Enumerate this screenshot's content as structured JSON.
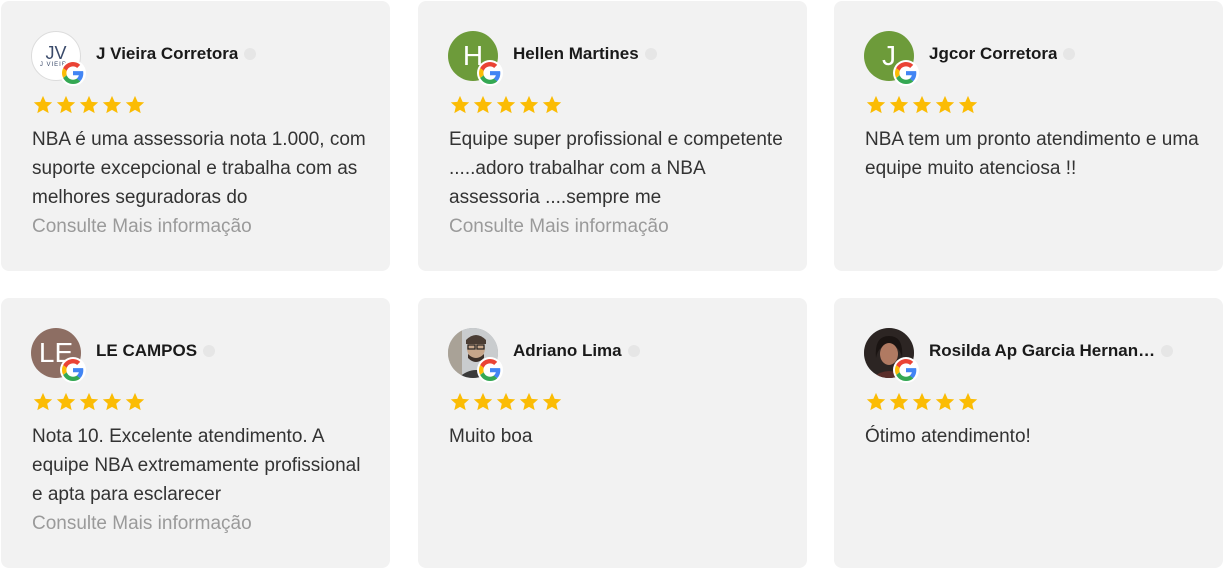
{
  "reviews": [
    {
      "name": "J Vieira Corretora",
      "avatar": {
        "type": "logo",
        "initials": "JV",
        "subtext": "J VIEIRA",
        "color": "#ffffff"
      },
      "rating": 5,
      "text": "NBA é uma assessoria nota 1.000, com suporte excepcional e trabalha com as melhores seguradoras do",
      "more_label": "Consulte Mais informação",
      "source_icon": "google-icon"
    },
    {
      "name": "Hellen Martines",
      "avatar": {
        "type": "initial",
        "initials": "H",
        "color": "#6d9b3a"
      },
      "rating": 5,
      "text": "Equipe super profissional e competente .....adoro trabalhar com a NBA assessoria ....sempre me",
      "more_label": "Consulte Mais informação",
      "source_icon": "google-icon"
    },
    {
      "name": "Jgcor Corretora",
      "avatar": {
        "type": "initial",
        "initials": "J",
        "color": "#6d9b3a"
      },
      "rating": 5,
      "text": "NBA tem um pronto atendimento e uma equipe muito atenciosa !!",
      "more_label": "",
      "source_icon": "google-icon"
    },
    {
      "name": "LE CAMPOS",
      "avatar": {
        "type": "initial",
        "initials": "LE",
        "color": "#8d6e63"
      },
      "rating": 5,
      "text": "Nota 10. Excelente atendimento. A equipe NBA extremamente profissional e apta para esclarecer",
      "more_label": "Consulte Mais informação",
      "source_icon": "google-icon"
    },
    {
      "name": "Adriano Lima",
      "avatar": {
        "type": "photo",
        "initials": "",
        "color": "#b8bcc0"
      },
      "rating": 5,
      "text": "Muito boa",
      "more_label": "",
      "source_icon": "google-icon"
    },
    {
      "name": "Rosilda Ap Garcia Hernan…",
      "avatar": {
        "type": "photo",
        "initials": "",
        "color": "#3e3432"
      },
      "rating": 5,
      "text": "Ótimo atendimento!",
      "more_label": "",
      "source_icon": "google-icon"
    }
  ],
  "colors": {
    "card_bg": "#f2f2f2",
    "star": "#fbbc04",
    "text": "#333333",
    "more": "#9a9a9a"
  }
}
